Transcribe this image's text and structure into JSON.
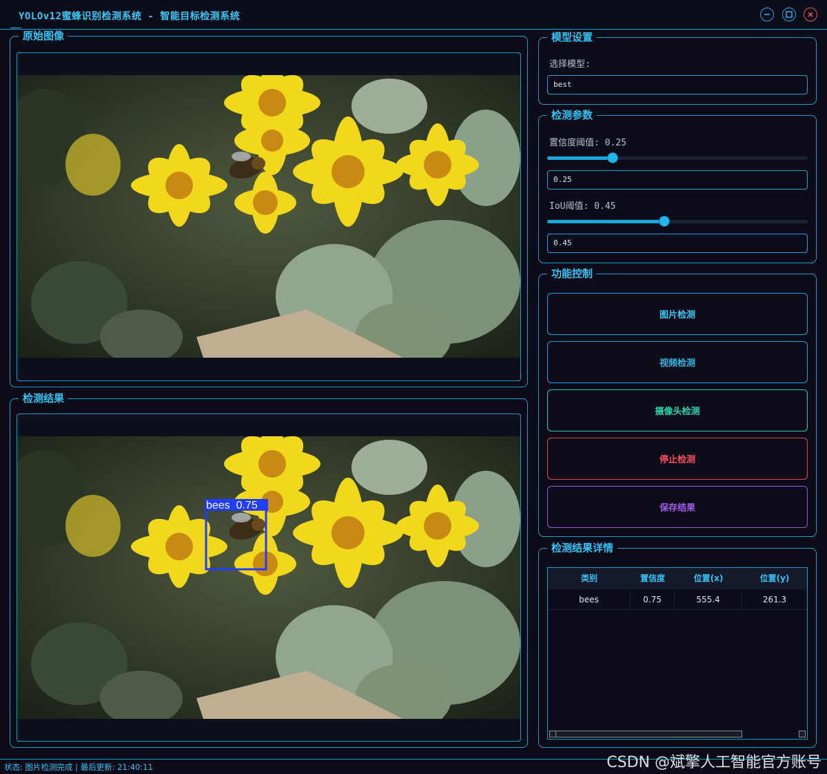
{
  "window": {
    "title": "YOLOv12蜜蜂识别检测系统 - 智能目标检测系统",
    "controls": [
      "minimize-icon",
      "maximize-icon",
      "close-icon"
    ]
  },
  "panels": {
    "original": {
      "title": "原始图像"
    },
    "result": {
      "title": "检测结果",
      "box_label": "bees  0.75"
    }
  },
  "model": {
    "title": "模型设置",
    "select_label": "选择模型:",
    "selected": "best"
  },
  "params": {
    "title": "检测参数",
    "confidence_label": "置信度阈值: 0.25",
    "confidence_value": "0.25",
    "confidence": 0.25,
    "iou_label": "IoU阈值: 0.45",
    "iou_value": "0.45",
    "iou": 0.45
  },
  "controls": {
    "title": "功能控制",
    "image_detect": "图片检测",
    "video_detect": "视频检测",
    "camera_detect": "摄像头检测",
    "stop_detect": "停止检测",
    "save_result": "保存结果"
  },
  "details": {
    "title": "检测结果详情",
    "columns": [
      "类别",
      "置信度",
      "位置(x)",
      "位置(y)"
    ],
    "rows": [
      [
        "bees",
        "0.75",
        "555.4",
        "261.3"
      ]
    ]
  },
  "status": "状态: 图片检测完成 | 最后更新: 21:40:11",
  "watermark": "CSDN @斌擎人工智能官方账号",
  "colors": {
    "accent": "#1a9fd4",
    "camera_btn": "#1fd3a4",
    "stop_btn": "#ff4d5e",
    "save_btn": "#a45af0",
    "detect_box": "#1f3cff"
  }
}
